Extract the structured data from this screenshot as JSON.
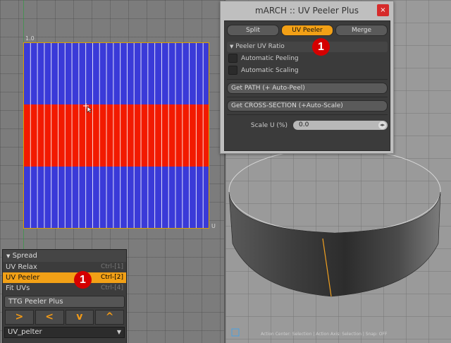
{
  "uv_view": {
    "axis_top": "1.0",
    "axis_right": "U"
  },
  "tool_panel": {
    "header": "Spread",
    "items": [
      {
        "label": "UV Relax",
        "shortcut": "Ctrl-[1]",
        "selected": false
      },
      {
        "label": "UV Peeler",
        "shortcut": "Ctrl-[2]",
        "selected": true
      },
      {
        "label": "Fit UVs",
        "shortcut": "Ctrl-[4]",
        "selected": false
      }
    ],
    "ttg_button": "TTG Peeler Plus",
    "arrows": [
      ">",
      "<",
      "v",
      "^"
    ],
    "dropdown_value": "UV_pelter"
  },
  "window": {
    "title": "mARCH :: UV Peeler Plus",
    "close": "×",
    "tabs": [
      "Split",
      "UV Peeler",
      "Merge"
    ],
    "active_tab": 1,
    "section": "Peeler UV Ratio",
    "checks": [
      "Automatic Peeling",
      "Automatic Scaling"
    ],
    "btn_path": "Get PATH (+ Auto-Peel)",
    "btn_cross": "Get CROSS-SECTION (+Auto-Scale)",
    "scale_label": "Scale U (%)",
    "scale_value": "0.0"
  },
  "badges": [
    "1",
    "1"
  ],
  "viewport_status": "Action Center: Selection | Action Axis: Selection | Snap: OFF",
  "colors": {
    "accent": "#f2a016",
    "uv_blue": "#3a3ad8",
    "uv_red": "#f21a00",
    "badge_red": "#d40000"
  }
}
